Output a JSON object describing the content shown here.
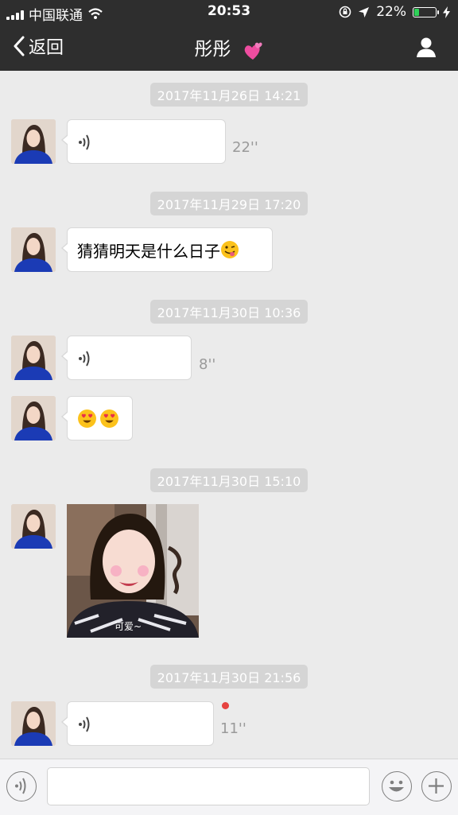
{
  "status_bar": {
    "carrier": "中国联通",
    "time": "20:53",
    "battery_percent": "22%",
    "battery_level": 0.22,
    "battery_color": "#2fd158"
  },
  "nav": {
    "back_label": "返回",
    "title": "彤彤",
    "title_emoji_icon": "two-hearts-icon",
    "profile_icon": "person-icon"
  },
  "messages": [
    {
      "timestamp": "2017年11月26日 14:21",
      "type": "voice",
      "duration": "22''"
    },
    {
      "timestamp": "2017年11月29日 17:20",
      "type": "text",
      "text": "猜猜明天是什么日子",
      "emoji_icon": "winking-tongue-emoji-icon"
    },
    {
      "timestamp": "2017年11月30日 10:36",
      "type": "voice",
      "duration": "8''"
    },
    {
      "type": "emoji",
      "emoji_icons": [
        "heart-eyes-emoji-icon",
        "heart-eyes-emoji-icon"
      ]
    },
    {
      "timestamp": "2017年11月30日 15:10",
      "type": "image",
      "caption": "可爱~"
    },
    {
      "timestamp": "2017年11月30日 21:56",
      "type": "voice",
      "duration": "11''",
      "unread": true
    }
  ],
  "colors": {
    "unread_dot": "#e64340",
    "header_bg": "#2e2e2e",
    "chat_bg": "#ebebeb"
  },
  "input_bar": {
    "voice_icon": "voice-toggle-icon",
    "emoji_icon": "smiley-icon",
    "more_icon": "plus-icon",
    "input_value": ""
  }
}
